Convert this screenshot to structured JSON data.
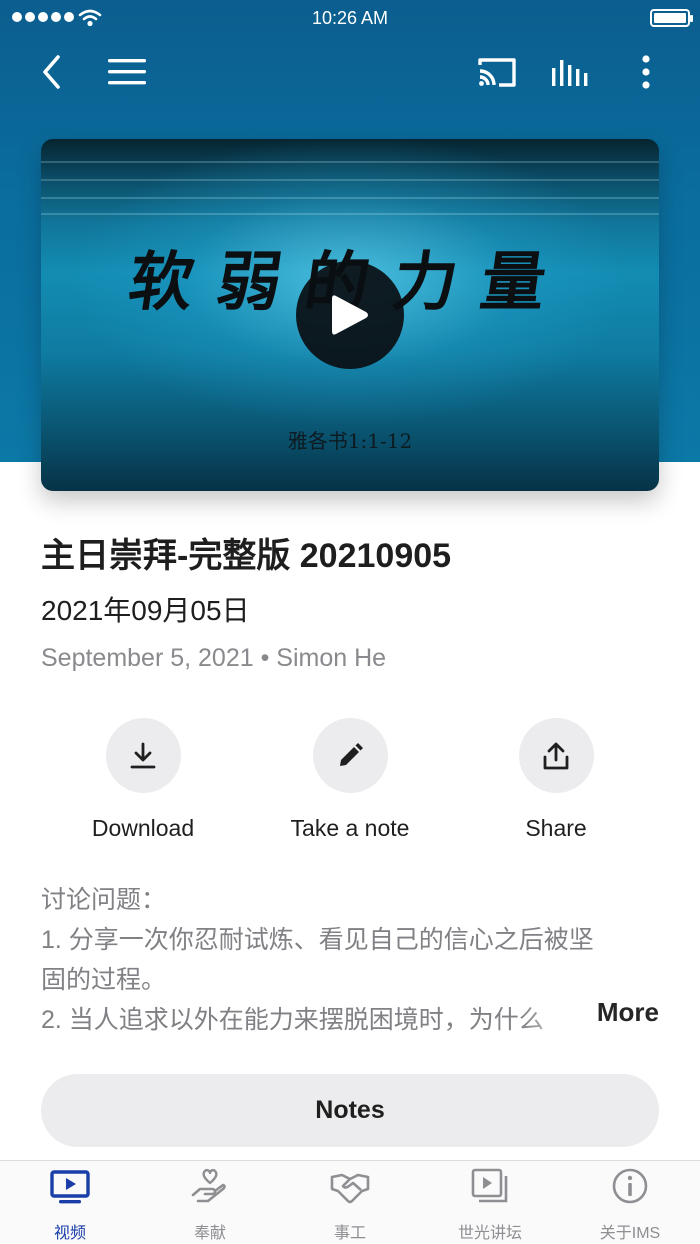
{
  "status_bar": {
    "time": "10:26 AM"
  },
  "colors": {
    "header_blue": "#0a6e9e",
    "tab_active": "#1a3ea8",
    "tab_inactive": "#8e8e93",
    "button_gray": "#ececee"
  },
  "toolbar": {
    "icons": [
      "back-icon",
      "menu-icon",
      "cast-icon",
      "audio-icon",
      "more-vertical-icon"
    ]
  },
  "video": {
    "overlay_title": "软弱的力量",
    "overlay_subtitle": "雅各书1:1-12"
  },
  "sermon": {
    "title": "主日崇拜-完整版 20210905",
    "subtitle": "2021年09月05日",
    "meta": "September 5, 2021 • Simon He"
  },
  "actions": {
    "download": "Download",
    "note": "Take a note",
    "share": "Share"
  },
  "description": {
    "line1": "讨论问题：",
    "line2": "1. 分享一次你忍耐试炼、看见自己的信心之后被坚",
    "line3": "固的过程。",
    "line4": "2. 当人追求以外在能力来摆脱困境时，为什么",
    "more": "More"
  },
  "notes_button": "Notes",
  "tabs": [
    {
      "label": "视频",
      "icon": "tv-icon",
      "active": true
    },
    {
      "label": "奉献",
      "icon": "giving-hand-icon",
      "active": false
    },
    {
      "label": "事工",
      "icon": "handshake-icon",
      "active": false
    },
    {
      "label": "世光讲坛",
      "icon": "pulpit-video-icon",
      "active": false
    },
    {
      "label": "关于IMS",
      "icon": "info-icon",
      "active": false
    }
  ]
}
